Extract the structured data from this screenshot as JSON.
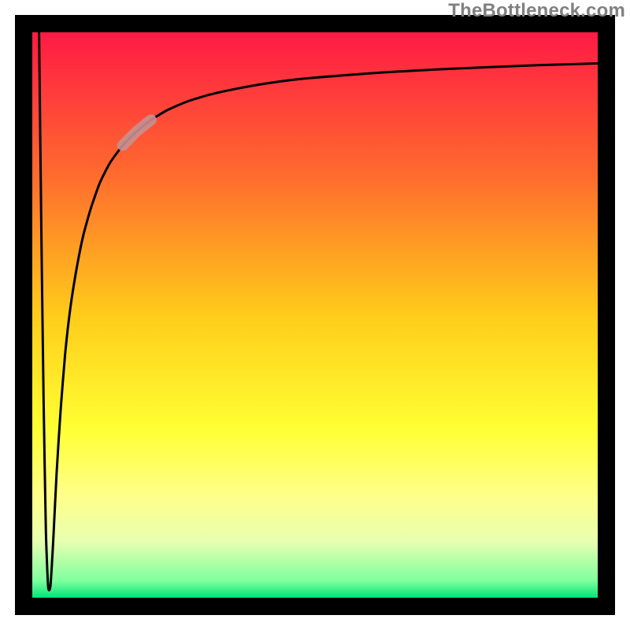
{
  "watermark": "TheBottleneck.com",
  "chart_data": {
    "type": "line",
    "title": "",
    "xlabel": "",
    "ylabel": "",
    "xlim": [
      0,
      100
    ],
    "ylim": [
      0,
      100
    ],
    "grid": false,
    "legend": false,
    "background_gradient": {
      "stops": [
        {
          "offset": 0.0,
          "color": "#ff1a45"
        },
        {
          "offset": 0.25,
          "color": "#ff6a2e"
        },
        {
          "offset": 0.5,
          "color": "#ffcc1a"
        },
        {
          "offset": 0.7,
          "color": "#ffff33"
        },
        {
          "offset": 0.82,
          "color": "#ffff8a"
        },
        {
          "offset": 0.9,
          "color": "#e8ffb0"
        },
        {
          "offset": 0.97,
          "color": "#7fff9e"
        },
        {
          "offset": 1.0,
          "color": "#00e676"
        }
      ]
    },
    "series": [
      {
        "name": "curve",
        "color": "#000000",
        "x": [
          1.2,
          1.6,
          2.0,
          2.4,
          2.8,
          3.2,
          3.7,
          4.3,
          5.0,
          5.8,
          6.7,
          7.8,
          9.0,
          10.4,
          12.0,
          13.8,
          16.0,
          18.5,
          21.0,
          24.0,
          27.5,
          31.5,
          36.0,
          41.0,
          47.0,
          54.0,
          62.0,
          71.0,
          80.0,
          90.0,
          100.0
        ],
        "y": [
          100.0,
          65.0,
          35.0,
          12.0,
          2.0,
          2.0,
          10.0,
          22.0,
          33.0,
          43.0,
          51.0,
          58.0,
          64.0,
          69.0,
          73.5,
          77.0,
          80.0,
          82.5,
          84.5,
          86.3,
          87.8,
          89.0,
          90.0,
          90.9,
          91.7,
          92.3,
          92.9,
          93.4,
          93.8,
          94.2,
          94.5
        ]
      }
    ],
    "highlight_segment": {
      "x_start": 16.0,
      "x_end": 21.0,
      "color": "#c89090",
      "width": 14
    }
  }
}
